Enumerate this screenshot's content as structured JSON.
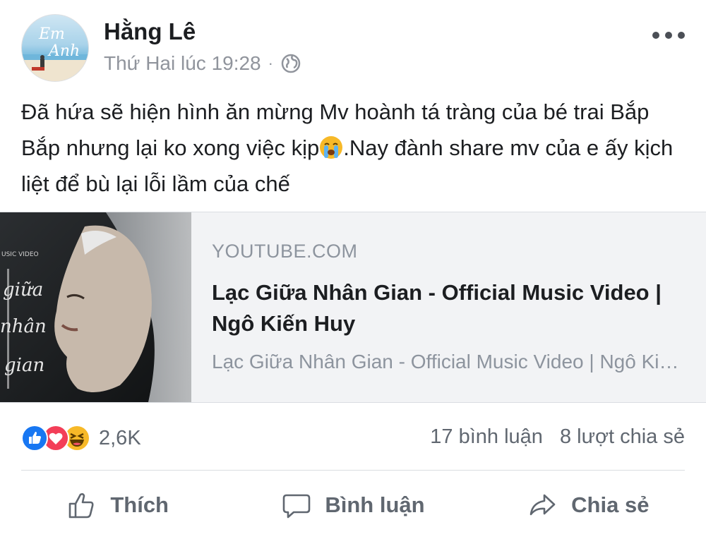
{
  "post": {
    "author": "Hằng Lê",
    "timestamp": "Thứ Hai lúc 19:28",
    "separator": "·",
    "privacy_icon": "globe-icon",
    "more_icon": "more-horizontal-icon",
    "text_part1": "Đã hứa sẽ hiện hình ăn mừng Mv hoành tá tràng của bé trai Bắp Bắp nhưng lại ko xong việc kịp",
    "emoji": "crying-face-emoji",
    "text_part2": ".Nay đành share mv của e ấy kịch liệt để bù lại lỗi lầm của chế"
  },
  "link_preview": {
    "domain": "YOUTUBE.COM",
    "title": "Lạc Giữa Nhân Gian - Official Music Video | Ngô Kiến Huy",
    "description": "Lạc Giữa Nhân Gian - Official Music Video | Ngô Kiến Huy"
  },
  "stats": {
    "reactions": [
      "like",
      "love",
      "haha"
    ],
    "reaction_count": "2,6K",
    "comments": "17 bình luận",
    "shares": "8 lượt chia sẻ"
  },
  "actions": {
    "like_label": "Thích",
    "comment_label": "Bình luận",
    "share_label": "Chia sẻ"
  },
  "colors": {
    "like_blue": "#1877f2",
    "love_red": "#f33e58",
    "haha_yellow": "#f7b928",
    "muted_text": "#606770",
    "card_bg": "#f2f3f5"
  }
}
